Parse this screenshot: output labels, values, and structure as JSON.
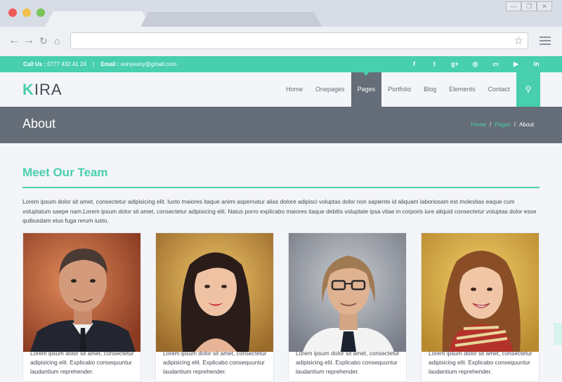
{
  "browser": {
    "url": "",
    "window_buttons": [
      "—",
      "❐",
      "✕"
    ]
  },
  "topbar": {
    "call_label": "Call Us :",
    "phone": "0777 432 41 24",
    "email_label": "Email :",
    "email": "eonyeony@gmail.com",
    "social_icons": [
      "facebook-icon",
      "twitter-icon",
      "google-plus-icon",
      "dribbble-icon",
      "flickr-icon",
      "youtube-icon",
      "linkedin-icon"
    ],
    "social_glyphs": [
      "f",
      "t",
      "g+",
      "◎",
      "▭",
      "▶",
      "in"
    ],
    "social_colors": [
      "#48cfad",
      "#48cfad",
      "#48cfad",
      "#48cfad",
      "#48cfad",
      "#48cfad",
      "#48cfad"
    ]
  },
  "header": {
    "logo_initial": "K",
    "logo_rest": "IRA",
    "nav": [
      "Home",
      "Onepages",
      "Pages",
      "Portfolio",
      "Blog",
      "Elements",
      "Contact"
    ],
    "active_nav": "Pages"
  },
  "page": {
    "title": "About",
    "breadcrumb": [
      "Home",
      "Pages",
      "About"
    ]
  },
  "section": {
    "title_strong": "Meet",
    "title_rest": " Our Team",
    "intro": "Lorem ipsum dolor sit amet, consectetur adipisicing elit. Iusto maiores itaque animi aspernatur alias dolore adipisci voluptas dolor non sapiente id aliquam laboriosam est molestias eaque cum voluptatum saepe nam.Lorem ipsum dolor sit amet, consectetur adipisicing elit. Natus porro explicabo maiores itaque debitis voluptate ipsa vitae in corporis iure aliquid consectetur voluptas dolor esse quibusdam eius fuga rerum iusto."
  },
  "team": [
    {
      "bio": "Lorem ipsum dolor sit amet, consectetur adipisicing elit. Explicabo consequuntur laudantium reprehender."
    },
    {
      "bio": "Lorem ipsum dolor sit amet, consectetur adipisicing elit. Explicabo consequuntur laudantium reprehender."
    },
    {
      "bio": "Lorem ipsum dolor sit amet, consectetur adipisicing elit. Explicabo consequuntur laudantium reprehender."
    },
    {
      "bio": "Lorem ipsum dolor sit amet, consectetur adipisicing elit. Explicabo consequuntur laudantium reprehender."
    }
  ],
  "colors": {
    "accent": "#48cfad",
    "dark": "#656d78",
    "text": "#434a54"
  }
}
